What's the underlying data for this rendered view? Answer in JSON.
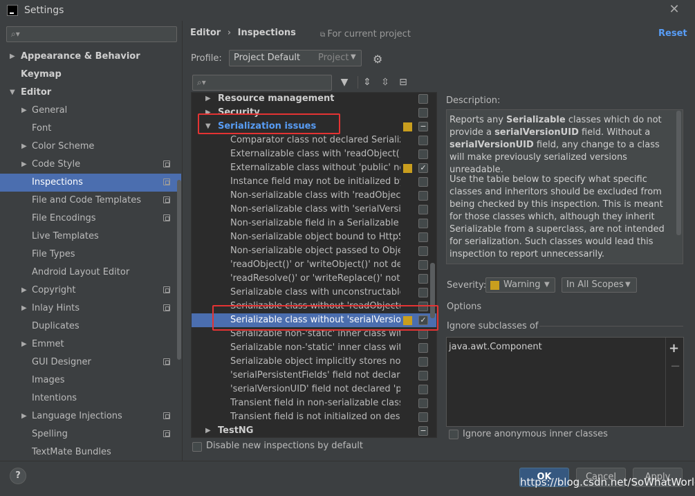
{
  "window": {
    "title": "Settings"
  },
  "sidebar": {
    "search_placeholder": "",
    "items": [
      {
        "label": "Appearance & Behavior",
        "expanded": false,
        "has_children": true
      },
      {
        "label": "Keymap"
      },
      {
        "label": "Editor",
        "expanded": true,
        "has_children": true
      },
      {
        "label": "General",
        "has_children": true
      },
      {
        "label": "Font"
      },
      {
        "label": "Color Scheme",
        "has_children": true
      },
      {
        "label": "Code Style",
        "has_children": true,
        "project_icon": true
      },
      {
        "label": "Inspections",
        "selected": true,
        "project_icon": true
      },
      {
        "label": "File and Code Templates",
        "project_icon": true
      },
      {
        "label": "File Encodings",
        "project_icon": true
      },
      {
        "label": "Live Templates"
      },
      {
        "label": "File Types"
      },
      {
        "label": "Android Layout Editor"
      },
      {
        "label": "Copyright",
        "has_children": true,
        "project_icon": true
      },
      {
        "label": "Inlay Hints",
        "has_children": true,
        "project_icon": true
      },
      {
        "label": "Duplicates"
      },
      {
        "label": "Emmet",
        "has_children": true
      },
      {
        "label": "GUI Designer",
        "project_icon": true
      },
      {
        "label": "Images"
      },
      {
        "label": "Intentions"
      },
      {
        "label": "Language Injections",
        "has_children": true,
        "project_icon": true
      },
      {
        "label": "Spelling",
        "project_icon": true
      },
      {
        "label": "TextMate Bundles"
      }
    ]
  },
  "header": {
    "breadcrumb_editor": "Editor",
    "breadcrumb_sep": "›",
    "breadcrumb_inspections": "Inspections",
    "for_project": "For current project",
    "reset": "Reset"
  },
  "profile": {
    "label": "Profile:",
    "value": "Project Default",
    "scope": "Project"
  },
  "inspections": {
    "rows": [
      {
        "name": "Resource management",
        "kind": "group",
        "state": "empty"
      },
      {
        "name": "Security",
        "kind": "group",
        "state": "empty"
      },
      {
        "name": "Serialization issues",
        "kind": "group-open",
        "state": "partial",
        "sev": true
      },
      {
        "name": "Comparator class not declared Serializab",
        "state": "empty"
      },
      {
        "name": "Externalizable class with 'readObject()' o",
        "state": "empty"
      },
      {
        "name": "Externalizable class without 'public' no-a",
        "state": "checked",
        "sev": true
      },
      {
        "name": "Instance field may not be initialized by 'r",
        "state": "empty"
      },
      {
        "name": "Non-serializable class with 'readObject()'",
        "state": "empty"
      },
      {
        "name": "Non-serializable class with 'serialVersion",
        "state": "empty"
      },
      {
        "name": "Non-serializable field in a Serializable cla",
        "state": "empty"
      },
      {
        "name": "Non-serializable object bound to HttpSe",
        "state": "empty"
      },
      {
        "name": "Non-serializable object passed to Object",
        "state": "empty"
      },
      {
        "name": "'readObject()' or 'writeObject()' not decla",
        "state": "empty"
      },
      {
        "name": "'readResolve()' or 'writeReplace()' not dec",
        "state": "empty"
      },
      {
        "name": "Serializable class with unconstructable a",
        "state": "empty"
      },
      {
        "name": "Serializable class without 'readObject()' o",
        "state": "empty"
      },
      {
        "name": "Serializable class without 'serialVersionU",
        "state": "checked",
        "sev": true,
        "selected": true
      },
      {
        "name": "Serializable non-'static' inner class with r",
        "state": "empty"
      },
      {
        "name": "Serializable non-'static' inner class witho",
        "state": "empty"
      },
      {
        "name": "Serializable object implicitly stores non-S",
        "state": "empty"
      },
      {
        "name": "'serialPersistentFields' field not declared",
        "state": "empty"
      },
      {
        "name": "'serialVersionUID' field not declared 'priv",
        "state": "empty"
      },
      {
        "name": "Transient field in non-serializable class",
        "state": "empty"
      },
      {
        "name": "Transient field is not initialized on deseri",
        "state": "empty"
      },
      {
        "name": "TestNG",
        "kind": "group",
        "state": "partial"
      }
    ],
    "disable_new": "Disable new inspections by default"
  },
  "description": {
    "label": "Description:",
    "p1_parts": [
      "Reports any ",
      "Serializable",
      " classes which do not provide a ",
      "serialVersionUID",
      " field. Without a ",
      "serialVersionUID",
      " field, any change to a class will make previously serialized versions unreadable."
    ],
    "p2": "Use the table below to specify what specific classes and inheritors should be excluded from being checked by this inspection. This is meant for those classes which, although they inherit Serializable from a superclass, are not intended for serialization. Such classes would lead this inspection to report unnecessarily."
  },
  "severity": {
    "label": "Severity:",
    "value": "Warning",
    "scope": "In All Scopes"
  },
  "options": {
    "label": "Options",
    "ignore_label": "Ignore subclasses of",
    "ignore_items": [
      "java.awt.Component"
    ],
    "anon_label": "Ignore anonymous inner classes"
  },
  "footer": {
    "help": "?",
    "ok": "OK",
    "cancel": "Cancel",
    "apply": "Apply",
    "watermark": "https://blog.csdn.net/SoWhatWorld"
  },
  "colors": {
    "accent": "#4b6eaf",
    "link": "#589df6",
    "warning": "#c99e1e",
    "highlight": "#e53333"
  }
}
